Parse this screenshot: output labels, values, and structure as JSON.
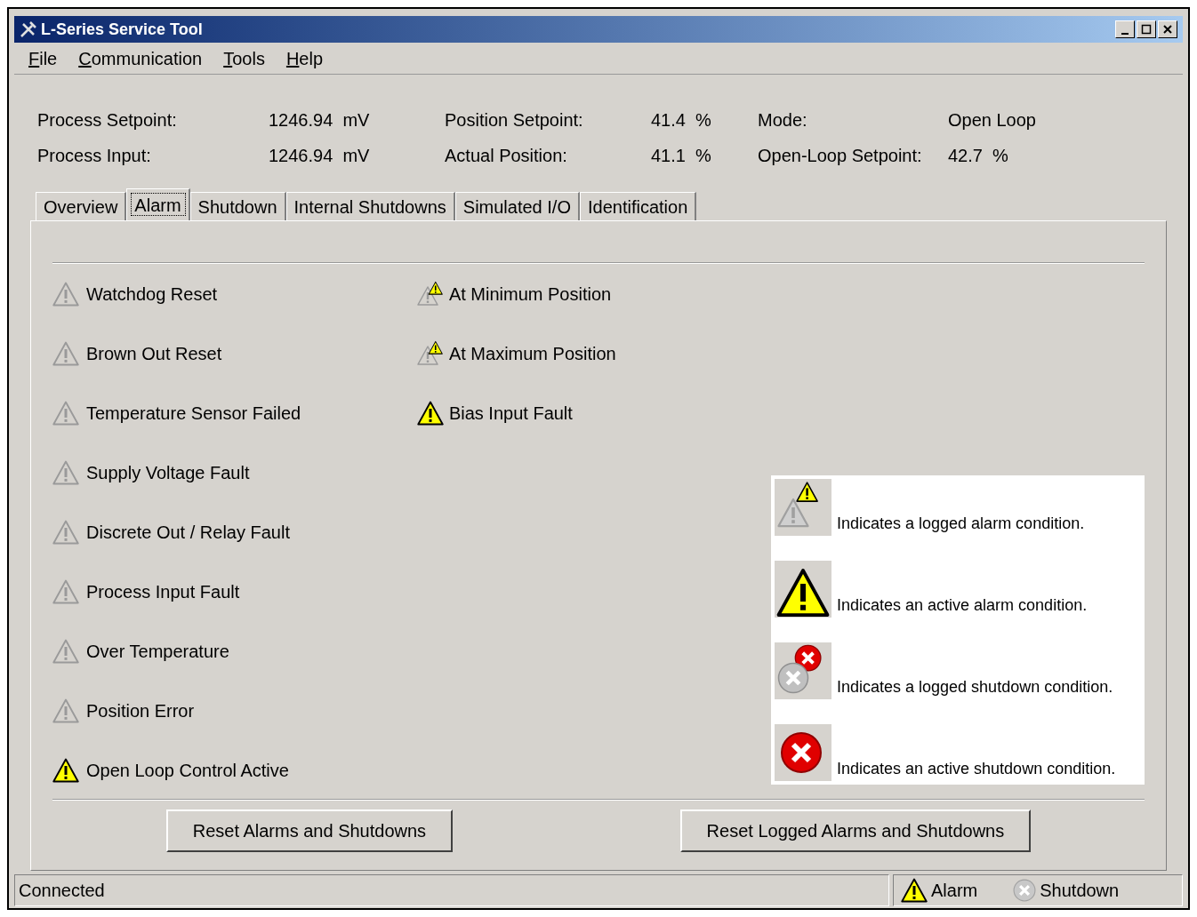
{
  "window": {
    "title": "L-Series Service Tool"
  },
  "menu": [
    "File",
    "Communication",
    "Tools",
    "Help"
  ],
  "readouts": [
    {
      "label": "Process Setpoint:",
      "value": "1246.94  mV"
    },
    {
      "label": "Position Setpoint:",
      "value": "41.4  %"
    },
    {
      "label": "Mode:",
      "value": "Open Loop"
    },
    {
      "label": "Process Input:",
      "value": "1246.94  mV"
    },
    {
      "label": "Actual Position:",
      "value": "41.1  %"
    },
    {
      "label": "Open-Loop Setpoint:",
      "value": "42.7  %"
    }
  ],
  "tabs": [
    {
      "label": "Overview",
      "selected": false
    },
    {
      "label": "Alarm",
      "selected": true
    },
    {
      "label": "Shutdown",
      "selected": false
    },
    {
      "label": "Internal Shutdowns",
      "selected": false
    },
    {
      "label": "Simulated I/O",
      "selected": false
    },
    {
      "label": "Identification",
      "selected": false
    }
  ],
  "alarms_left": [
    {
      "label": "Watchdog Reset",
      "active": false,
      "logged": false
    },
    {
      "label": "Brown Out Reset",
      "active": false,
      "logged": false
    },
    {
      "label": "Temperature Sensor Failed",
      "active": false,
      "logged": false
    },
    {
      "label": "Supply Voltage Fault",
      "active": false,
      "logged": false
    },
    {
      "label": "Discrete Out / Relay Fault",
      "active": false,
      "logged": false
    },
    {
      "label": "Process Input Fault",
      "active": false,
      "logged": false
    },
    {
      "label": "Over Temperature",
      "active": false,
      "logged": false
    },
    {
      "label": "Position Error",
      "active": false,
      "logged": false
    },
    {
      "label": "Open Loop Control Active",
      "active": true,
      "logged": false
    }
  ],
  "alarms_right": [
    {
      "label": "At Minimum Position",
      "active": false,
      "logged": true
    },
    {
      "label": "At Maximum Position",
      "active": false,
      "logged": true
    },
    {
      "label": "Bias Input Fault",
      "active": true,
      "logged": false
    }
  ],
  "legend": [
    {
      "kind": "logged_alarm",
      "text": "Indicates a logged alarm condition."
    },
    {
      "kind": "active_alarm",
      "text": "Indicates an active alarm condition."
    },
    {
      "kind": "logged_shutdown",
      "text": "Indicates a logged shutdown condition."
    },
    {
      "kind": "active_shutdown",
      "text": "Indicates an active shutdown condition."
    }
  ],
  "buttons": [
    "Reset Alarms and Shutdowns",
    "Reset Logged Alarms and Shutdowns"
  ],
  "status_bar": {
    "text": "Connected",
    "indicators": [
      {
        "kind": "alarm",
        "label": "Alarm",
        "active": true
      },
      {
        "kind": "shutdown",
        "label": "Shutdown",
        "active": false
      }
    ]
  }
}
